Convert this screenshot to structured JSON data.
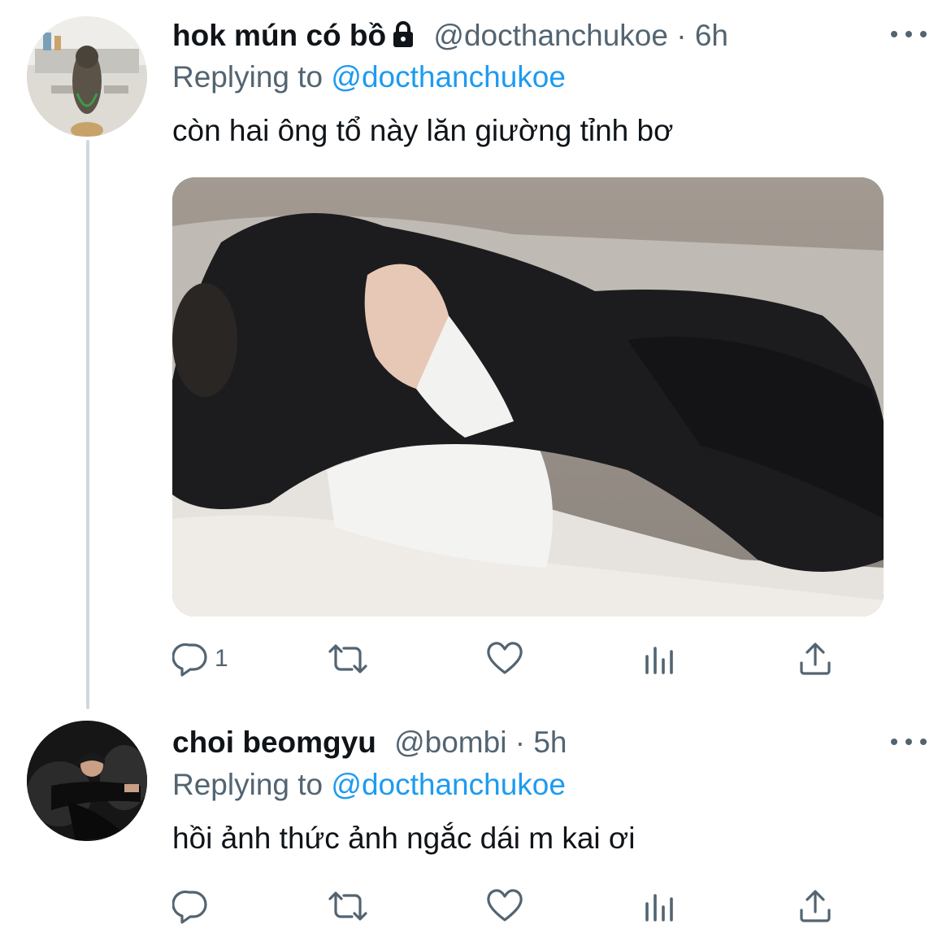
{
  "tweets": [
    {
      "display_name": "hok mún có bồ",
      "protected_icon": "lock-icon",
      "handle": "@docthanchukoe",
      "separator": "·",
      "time": "6h",
      "replying_prefix": "Replying to",
      "replying_to": "@docthanchukoe",
      "text": "còn hai ông tổ này lăn giường tỉnh bơ",
      "has_media": true,
      "actions": {
        "reply_count": "1",
        "retweet_count": "",
        "like_count": ""
      }
    },
    {
      "display_name": "choi beomgyu",
      "handle": "@bombi",
      "separator": "·",
      "time": "5h",
      "replying_prefix": "Replying to",
      "replying_to": "@docthanchukoe",
      "text": "hồi ảnh thức ảnh ngắc dái m kai ơi",
      "has_media": false,
      "actions": {
        "reply_count": "",
        "retweet_count": "",
        "like_count": ""
      }
    }
  ],
  "colors": {
    "text": "#0f1419",
    "secondary": "#536471",
    "link": "#1d9bf0",
    "thread_line": "#cfd9de"
  }
}
